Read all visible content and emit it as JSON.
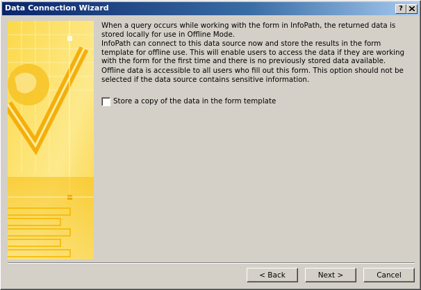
{
  "window": {
    "title": "Data Connection Wizard",
    "help_label": "?",
    "close_icon": "close-icon"
  },
  "main": {
    "paragraphs": [
      "When a query occurs while working with the form in InfoPath, the returned data is stored locally for use in Offline Mode.",
      "InfoPath can connect to this data source now and store the results in the form template for offline use. This will enable users to access the data if they are working with the form for the first time and there is no previously stored data available.",
      "Offline data is accessible to all users who fill out this form. This option should not be selected if the data source contains sensitive information."
    ],
    "store_copy_checkbox": {
      "label": "Store a copy of the data in the form template",
      "checked": false
    }
  },
  "buttons": {
    "back": "< Back",
    "next": "Next >",
    "cancel": "Cancel"
  },
  "colors": {
    "titlebar_start": "#0a246a",
    "titlebar_end": "#a6caf0",
    "dialog_face": "#d4d0c8",
    "art_yellow": "#fde67a",
    "art_orange": "#f5b400"
  }
}
